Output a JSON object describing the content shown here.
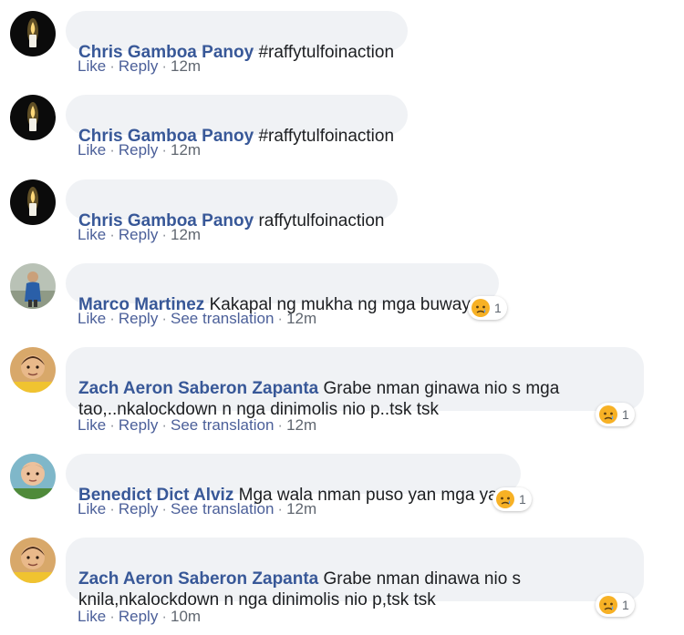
{
  "comments": [
    {
      "author": "Chris Gamboa Panoy",
      "text": "#raffytulfoinaction",
      "actions": [
        "Like",
        "Reply"
      ],
      "time": "12m",
      "avatar": "candle-avatar"
    },
    {
      "author": "Chris Gamboa Panoy",
      "text": "#raffytulfoinaction",
      "actions": [
        "Like",
        "Reply"
      ],
      "time": "12m",
      "avatar": "candle-avatar"
    },
    {
      "author": "Chris Gamboa Panoy",
      "text": "raffytulfoinaction",
      "actions": [
        "Like",
        "Reply"
      ],
      "time": "12m",
      "avatar": "candle-avatar"
    },
    {
      "author": "Marco Martinez",
      "text": "Kakapal ng mukha ng mga buwaya!",
      "actions": [
        "Like",
        "Reply",
        "See translation"
      ],
      "time": "12m",
      "avatar": "person-avatar",
      "reaction": {
        "icon": "sad-reaction-icon",
        "count": "1"
      }
    },
    {
      "author": "Zach Aeron Saberon Zapanta",
      "text": "Grabe nman ginawa nio s mga\ntao,..nkalockdown n nga dinimolis nio p..tsk tsk",
      "actions": [
        "Like",
        "Reply",
        "See translation"
      ],
      "time": "12m",
      "avatar": "child-avatar",
      "reaction": {
        "icon": "sad-reaction-icon",
        "count": "1"
      }
    },
    {
      "author": "Benedict Dict Alviz",
      "text": "Mga wala nman puso yan mga yan",
      "actions": [
        "Like",
        "Reply",
        "See translation"
      ],
      "time": "12m",
      "avatar": "child-avatar-2",
      "reaction": {
        "icon": "sad-reaction-icon",
        "count": "1"
      }
    },
    {
      "author": "Zach Aeron Saberon Zapanta",
      "text": "Grabe nman dinawa nio s\nknila,nkalockdown n nga dinimolis nio p,tsk tsk",
      "actions": [
        "Like",
        "Reply"
      ],
      "time": "10m",
      "avatar": "child-avatar",
      "reaction": {
        "icon": "sad-reaction-icon",
        "count": "1"
      }
    }
  ],
  "separator": "·",
  "colors": {
    "author": "#385898",
    "bubble": "#f0f2f5",
    "link": "#4b5f99",
    "meta": "#606770"
  }
}
